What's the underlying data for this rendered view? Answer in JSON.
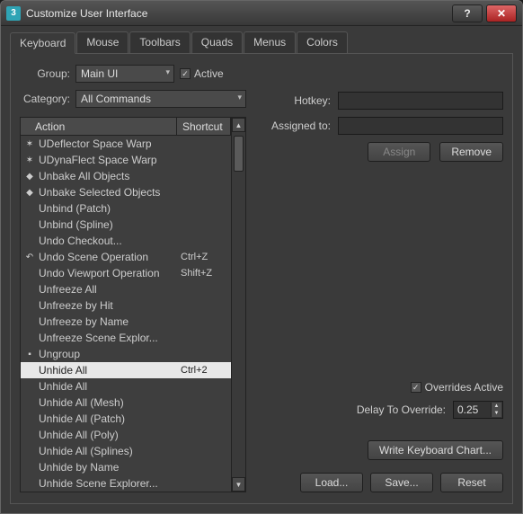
{
  "window": {
    "title": "Customize User Interface"
  },
  "tabs": [
    "Keyboard",
    "Mouse",
    "Toolbars",
    "Quads",
    "Menus",
    "Colors"
  ],
  "active_tab": 0,
  "group": {
    "label": "Group:",
    "value": "Main UI"
  },
  "active_checkbox": {
    "label": "Active",
    "checked": true
  },
  "category": {
    "label": "Category:",
    "value": "All Commands"
  },
  "list": {
    "headers": {
      "action": "Action",
      "shortcut": "Shortcut"
    },
    "items": [
      {
        "icon": "warp-icon",
        "iconGlyph": "✶",
        "name": "UDeflector Space Warp",
        "shortcut": ""
      },
      {
        "icon": "warp-icon",
        "iconGlyph": "✶",
        "name": "UDynaFlect Space Warp",
        "shortcut": ""
      },
      {
        "icon": "unbake-icon",
        "iconGlyph": "◆",
        "name": "Unbake All Objects",
        "shortcut": ""
      },
      {
        "icon": "unbake-icon",
        "iconGlyph": "◆",
        "name": "Unbake Selected Objects",
        "shortcut": ""
      },
      {
        "icon": "",
        "iconGlyph": "",
        "name": "Unbind (Patch)",
        "shortcut": ""
      },
      {
        "icon": "",
        "iconGlyph": "",
        "name": "Unbind (Spline)",
        "shortcut": ""
      },
      {
        "icon": "",
        "iconGlyph": "",
        "name": "Undo Checkout...",
        "shortcut": ""
      },
      {
        "icon": "undo-icon",
        "iconGlyph": "↶",
        "name": "Undo Scene Operation",
        "shortcut": "Ctrl+Z"
      },
      {
        "icon": "",
        "iconGlyph": "",
        "name": "Undo Viewport Operation",
        "shortcut": "Shift+Z"
      },
      {
        "icon": "",
        "iconGlyph": "",
        "name": "Unfreeze All",
        "shortcut": ""
      },
      {
        "icon": "",
        "iconGlyph": "",
        "name": "Unfreeze by Hit",
        "shortcut": ""
      },
      {
        "icon": "",
        "iconGlyph": "",
        "name": "Unfreeze by Name",
        "shortcut": ""
      },
      {
        "icon": "",
        "iconGlyph": "",
        "name": "Unfreeze Scene Explor...",
        "shortcut": ""
      },
      {
        "icon": "ungroup-icon",
        "iconGlyph": "▪",
        "name": "Ungroup",
        "shortcut": ""
      },
      {
        "icon": "",
        "iconGlyph": "",
        "name": "Unhide All",
        "shortcut": "Ctrl+2",
        "selected": true
      },
      {
        "icon": "",
        "iconGlyph": "",
        "name": "Unhide All",
        "shortcut": ""
      },
      {
        "icon": "",
        "iconGlyph": "",
        "name": "Unhide All (Mesh)",
        "shortcut": ""
      },
      {
        "icon": "",
        "iconGlyph": "",
        "name": "Unhide All (Patch)",
        "shortcut": ""
      },
      {
        "icon": "",
        "iconGlyph": "",
        "name": "Unhide All (Poly)",
        "shortcut": ""
      },
      {
        "icon": "",
        "iconGlyph": "",
        "name": "Unhide All (Splines)",
        "shortcut": ""
      },
      {
        "icon": "",
        "iconGlyph": "",
        "name": "Unhide by Name",
        "shortcut": ""
      },
      {
        "icon": "",
        "iconGlyph": "",
        "name": "Unhide Scene Explorer...",
        "shortcut": ""
      }
    ]
  },
  "hotkey": {
    "label": "Hotkey:",
    "value": ""
  },
  "assigned": {
    "label": "Assigned to:",
    "value": ""
  },
  "buttons": {
    "assign": "Assign",
    "remove": "Remove",
    "write_chart": "Write Keyboard Chart...",
    "load": "Load...",
    "save": "Save...",
    "reset": "Reset"
  },
  "overrides": {
    "label": "Overrides Active",
    "checked": true
  },
  "delay": {
    "label": "Delay To Override:",
    "value": "0.25"
  }
}
